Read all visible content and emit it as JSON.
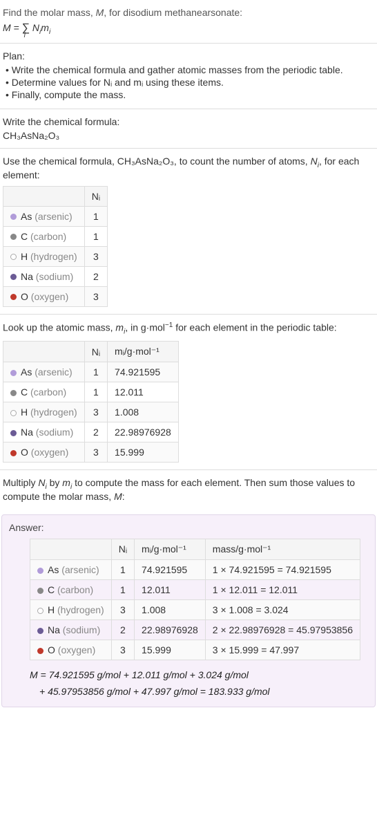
{
  "intro": {
    "prompt1": "Find the molar mass, ",
    "prompt_var": "M",
    "prompt2": ", for disodium methanearsonate:",
    "equation_lhs": "M = ",
    "equation_sum": "∑",
    "equation_sum_idx": "i",
    "equation_rhs_n": "N",
    "equation_rhs_m": "m",
    "equation_rhs_i": "i"
  },
  "plan": {
    "title": "Plan:",
    "items": [
      "• Write the chemical formula and gather atomic masses from the periodic table.",
      "• Determine values for Nᵢ and mᵢ using these items.",
      "• Finally, compute the mass."
    ]
  },
  "write_formula": {
    "prompt": "Write the chemical formula:",
    "formula": "CH₃AsNa₂O₃"
  },
  "count": {
    "prompt_a": "Use the chemical formula, CH₃AsNa₂O₃, to count the number of atoms, ",
    "prompt_n": "N",
    "prompt_i": "i",
    "prompt_b": ", for each element:",
    "header_n": "Nᵢ",
    "rows": [
      {
        "dot": "as",
        "sym": "As",
        "name": "(arsenic)",
        "n": "1"
      },
      {
        "dot": "c",
        "sym": "C",
        "name": "(carbon)",
        "n": "1"
      },
      {
        "dot": "h",
        "sym": "H",
        "name": "(hydrogen)",
        "n": "3"
      },
      {
        "dot": "na",
        "sym": "Na",
        "name": "(sodium)",
        "n": "2"
      },
      {
        "dot": "o",
        "sym": "O",
        "name": "(oxygen)",
        "n": "3"
      }
    ]
  },
  "lookup": {
    "prompt_a": "Look up the atomic mass, ",
    "prompt_m": "m",
    "prompt_i": "i",
    "prompt_b": ", in g·mol",
    "prompt_exp": "−1",
    "prompt_c": " for each element in the periodic table:",
    "header_n": "Nᵢ",
    "header_m": "mᵢ/g·mol⁻¹",
    "rows": [
      {
        "dot": "as",
        "sym": "As",
        "name": "(arsenic)",
        "n": "1",
        "m": "74.921595"
      },
      {
        "dot": "c",
        "sym": "C",
        "name": "(carbon)",
        "n": "1",
        "m": "12.011"
      },
      {
        "dot": "h",
        "sym": "H",
        "name": "(hydrogen)",
        "n": "3",
        "m": "1.008"
      },
      {
        "dot": "na",
        "sym": "Na",
        "name": "(sodium)",
        "n": "2",
        "m": "22.98976928"
      },
      {
        "dot": "o",
        "sym": "O",
        "name": "(oxygen)",
        "n": "3",
        "m": "15.999"
      }
    ]
  },
  "multiply": {
    "prompt_a": "Multiply ",
    "prompt_n": "N",
    "prompt_b": " by ",
    "prompt_m": "m",
    "prompt_i": "i",
    "prompt_c": " to compute the mass for each element. Then sum those values to compute the molar mass, ",
    "prompt_mm": "M",
    "prompt_d": ":"
  },
  "answer": {
    "title": "Answer:",
    "header_n": "Nᵢ",
    "header_m": "mᵢ/g·mol⁻¹",
    "header_mass": "mass/g·mol⁻¹",
    "rows": [
      {
        "dot": "as",
        "sym": "As",
        "name": "(arsenic)",
        "n": "1",
        "m": "74.921595",
        "mass": "1 × 74.921595 = 74.921595"
      },
      {
        "dot": "c",
        "sym": "C",
        "name": "(carbon)",
        "n": "1",
        "m": "12.011",
        "mass": "1 × 12.011 = 12.011"
      },
      {
        "dot": "h",
        "sym": "H",
        "name": "(hydrogen)",
        "n": "3",
        "m": "1.008",
        "mass": "3 × 1.008 = 3.024"
      },
      {
        "dot": "na",
        "sym": "Na",
        "name": "(sodium)",
        "n": "2",
        "m": "22.98976928",
        "mass": "2 × 22.98976928 = 45.97953856"
      },
      {
        "dot": "o",
        "sym": "O",
        "name": "(oxygen)",
        "n": "3",
        "m": "15.999",
        "mass": "3 × 15.999 = 47.997"
      }
    ],
    "final_line1": "M = 74.921595 g/mol + 12.011 g/mol + 3.024 g/mol",
    "final_line2": "+ 45.97953856 g/mol + 47.997 g/mol = 183.933 g/mol"
  },
  "chart_data": {
    "type": "table",
    "title": "Molar mass computation for CH₃AsNa₂O₃",
    "columns": [
      "element",
      "N_i",
      "m_i_g_per_mol",
      "mass_g_per_mol"
    ],
    "rows": [
      {
        "element": "As",
        "N_i": 1,
        "m_i_g_per_mol": 74.921595,
        "mass_g_per_mol": 74.921595
      },
      {
        "element": "C",
        "N_i": 1,
        "m_i_g_per_mol": 12.011,
        "mass_g_per_mol": 12.011
      },
      {
        "element": "H",
        "N_i": 3,
        "m_i_g_per_mol": 1.008,
        "mass_g_per_mol": 3.024
      },
      {
        "element": "Na",
        "N_i": 2,
        "m_i_g_per_mol": 22.98976928,
        "mass_g_per_mol": 45.97953856
      },
      {
        "element": "O",
        "N_i": 3,
        "m_i_g_per_mol": 15.999,
        "mass_g_per_mol": 47.997
      }
    ],
    "total_molar_mass_g_per_mol": 183.933
  }
}
